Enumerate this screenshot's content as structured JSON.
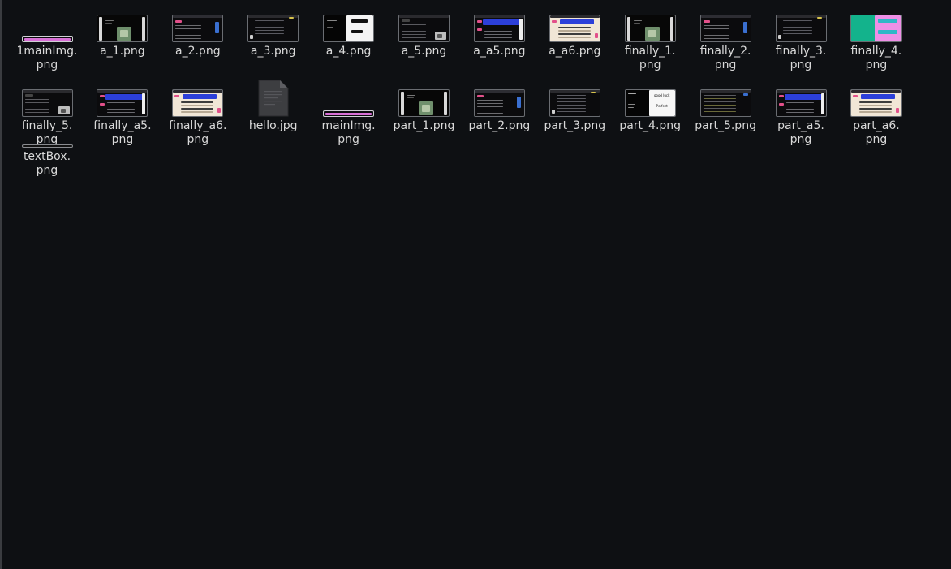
{
  "window": {
    "background": "#0e1013"
  },
  "files": [
    {
      "name": "1mainImg.png",
      "line1": "1mainImg.",
      "line2": "png",
      "thumb": "pink-strip"
    },
    {
      "name": "a_1.png",
      "line1": "a_1.png",
      "line2": "",
      "thumb": "photo-dark"
    },
    {
      "name": "a_2.png",
      "line1": "a_2.png",
      "line2": "",
      "thumb": "list-dark-pink"
    },
    {
      "name": "a_3.png",
      "line1": "a_3.png",
      "line2": "",
      "thumb": "list-dark"
    },
    {
      "name": "a_4.png",
      "line1": "a_4.png",
      "line2": "",
      "thumb": "black-white"
    },
    {
      "name": "a_5.png",
      "line1": "a_5.png",
      "line2": "",
      "thumb": "list-dark-img"
    },
    {
      "name": "a_a5.png",
      "line1": "a_a5.png",
      "line2": "",
      "thumb": "blue-banner"
    },
    {
      "name": "a_a6.png",
      "line1": "a_a6.png",
      "line2": "",
      "thumb": "beige-banner"
    },
    {
      "name": "finally_1.png",
      "line1": "finally_1.",
      "line2": "png",
      "thumb": "photo-dark"
    },
    {
      "name": "finally_2.png",
      "line1": "finally_2.",
      "line2": "png",
      "thumb": "list-dark-pink"
    },
    {
      "name": "finally_3.png",
      "line1": "finally_3.",
      "line2": "png",
      "thumb": "list-dark"
    },
    {
      "name": "finally_4.png",
      "line1": "finally_4.",
      "line2": "png",
      "thumb": "teal-pink"
    },
    {
      "name": "finally_5.png",
      "line1": "finally_5.",
      "line2": "png",
      "thumb": "list-dark-img"
    },
    {
      "name": "finally_a5.png",
      "line1": "finally_a5.",
      "line2": "png",
      "thumb": "blue-banner"
    },
    {
      "name": "finally_a6.png",
      "line1": "finally_a6.",
      "line2": "png",
      "thumb": "beige-banner"
    },
    {
      "name": "hello.jpg",
      "line1": "hello.jpg",
      "line2": "",
      "thumb": "document"
    },
    {
      "name": "mainImg.png",
      "line1": "mainImg.",
      "line2": "png",
      "thumb": "pink-strip"
    },
    {
      "name": "part_1.png",
      "line1": "part_1.png",
      "line2": "",
      "thumb": "photo-dark"
    },
    {
      "name": "part_2.png",
      "line1": "part_2.png",
      "line2": "",
      "thumb": "list-dark-pink"
    },
    {
      "name": "part_3.png",
      "line1": "part_3.png",
      "line2": "",
      "thumb": "list-dark"
    },
    {
      "name": "part_4.png",
      "line1": "part_4.png",
      "line2": "",
      "thumb": "black-white-text",
      "thumb_text": [
        "good luck",
        "Perfect"
      ]
    },
    {
      "name": "part_5.png",
      "line1": "part_5.png",
      "line2": "",
      "thumb": "list-dark-olive"
    },
    {
      "name": "part_a5.png",
      "line1": "part_a5.",
      "line2": "png",
      "thumb": "blue-banner"
    },
    {
      "name": "part_a6.png",
      "line1": "part_a6.",
      "line2": "png",
      "thumb": "beige-banner"
    },
    {
      "name": "textBox.png",
      "line1": "textBox.",
      "line2": "png",
      "thumb": "thin-line"
    }
  ]
}
